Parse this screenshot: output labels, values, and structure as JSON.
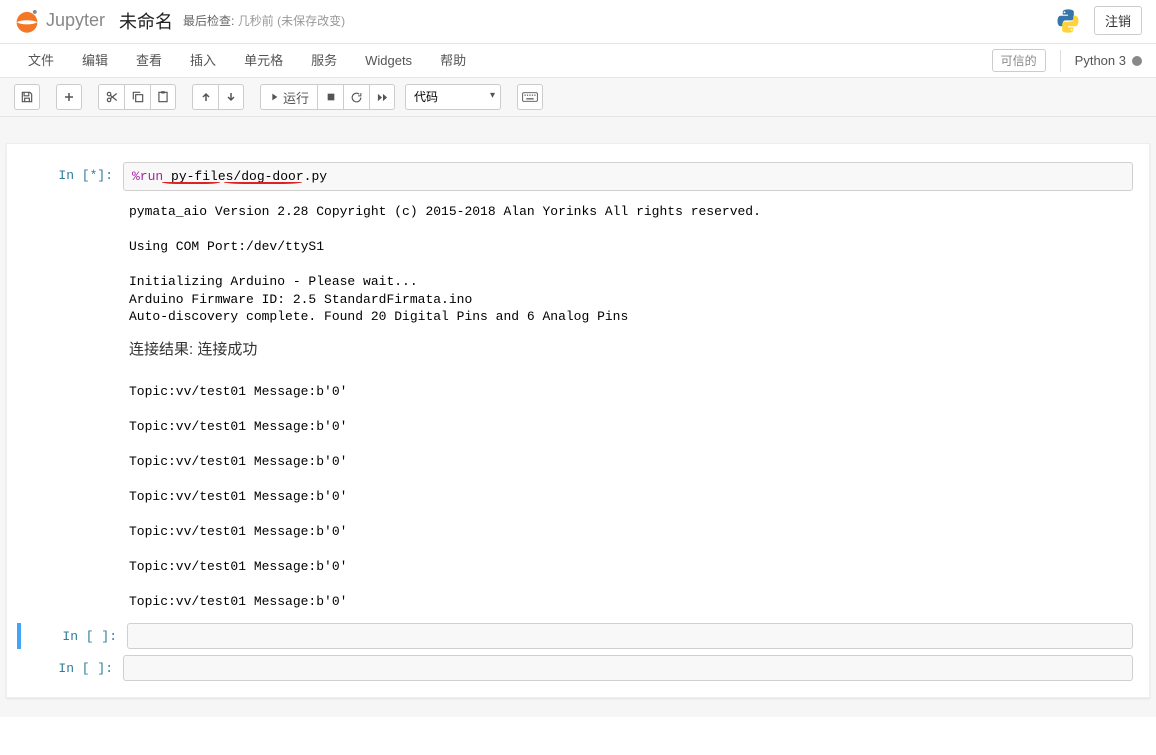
{
  "header": {
    "logo_text": "Jupyter",
    "notebook_name": "未命名",
    "checkpoint_label": "最后检查:",
    "checkpoint_time": "几秒前",
    "autosave_status": "(未保存改变)",
    "logout": "注销"
  },
  "menu": {
    "file": "文件",
    "edit": "编辑",
    "view": "查看",
    "insert": "插入",
    "cell": "单元格",
    "kernel": "服务",
    "widgets": "Widgets",
    "help": "帮助",
    "trusted": "可信的",
    "kernel_name": "Python 3"
  },
  "toolbar": {
    "save_icon": "save-icon",
    "add_icon": "plus-icon",
    "cut_icon": "scissors-icon",
    "copy_icon": "copy-icon",
    "paste_icon": "paste-icon",
    "up_icon": "arrow-up-icon",
    "down_icon": "arrow-down-icon",
    "run_label": "运行",
    "stop_icon": "stop-icon",
    "restart_icon": "refresh-icon",
    "ff_icon": "fast-forward-icon",
    "cell_type_value": "代码",
    "cmd_palette_icon": "keyboard-icon"
  },
  "cells": [
    {
      "prompt": "In  [*]:",
      "code_magic": "%run ",
      "code_rest": "py-files/dog-door.py",
      "output_lines_1": "pymata_aio Version 2.28 Copyright (c) 2015-2018 Alan Yorinks All rights reserved.\n\nUsing COM Port:/dev/ttyS1\n\nInitializing Arduino - Please wait...\nArduino Firmware ID: 2.5 StandardFirmata.ino\nAuto-discovery complete. Found 20 Digital Pins and 6 Analog Pins",
      "output_cn": "连接结果: 连接成功",
      "output_lines_2": "Topic:vv/test01 Message:b'0'\n\nTopic:vv/test01 Message:b'0'\n\nTopic:vv/test01 Message:b'0'\n\nTopic:vv/test01 Message:b'0'\n\nTopic:vv/test01 Message:b'0'\n\nTopic:vv/test01 Message:b'0'\n\nTopic:vv/test01 Message:b'0'"
    },
    {
      "prompt": "In  [  ]:"
    },
    {
      "prompt": "In  [  ]:"
    }
  ]
}
